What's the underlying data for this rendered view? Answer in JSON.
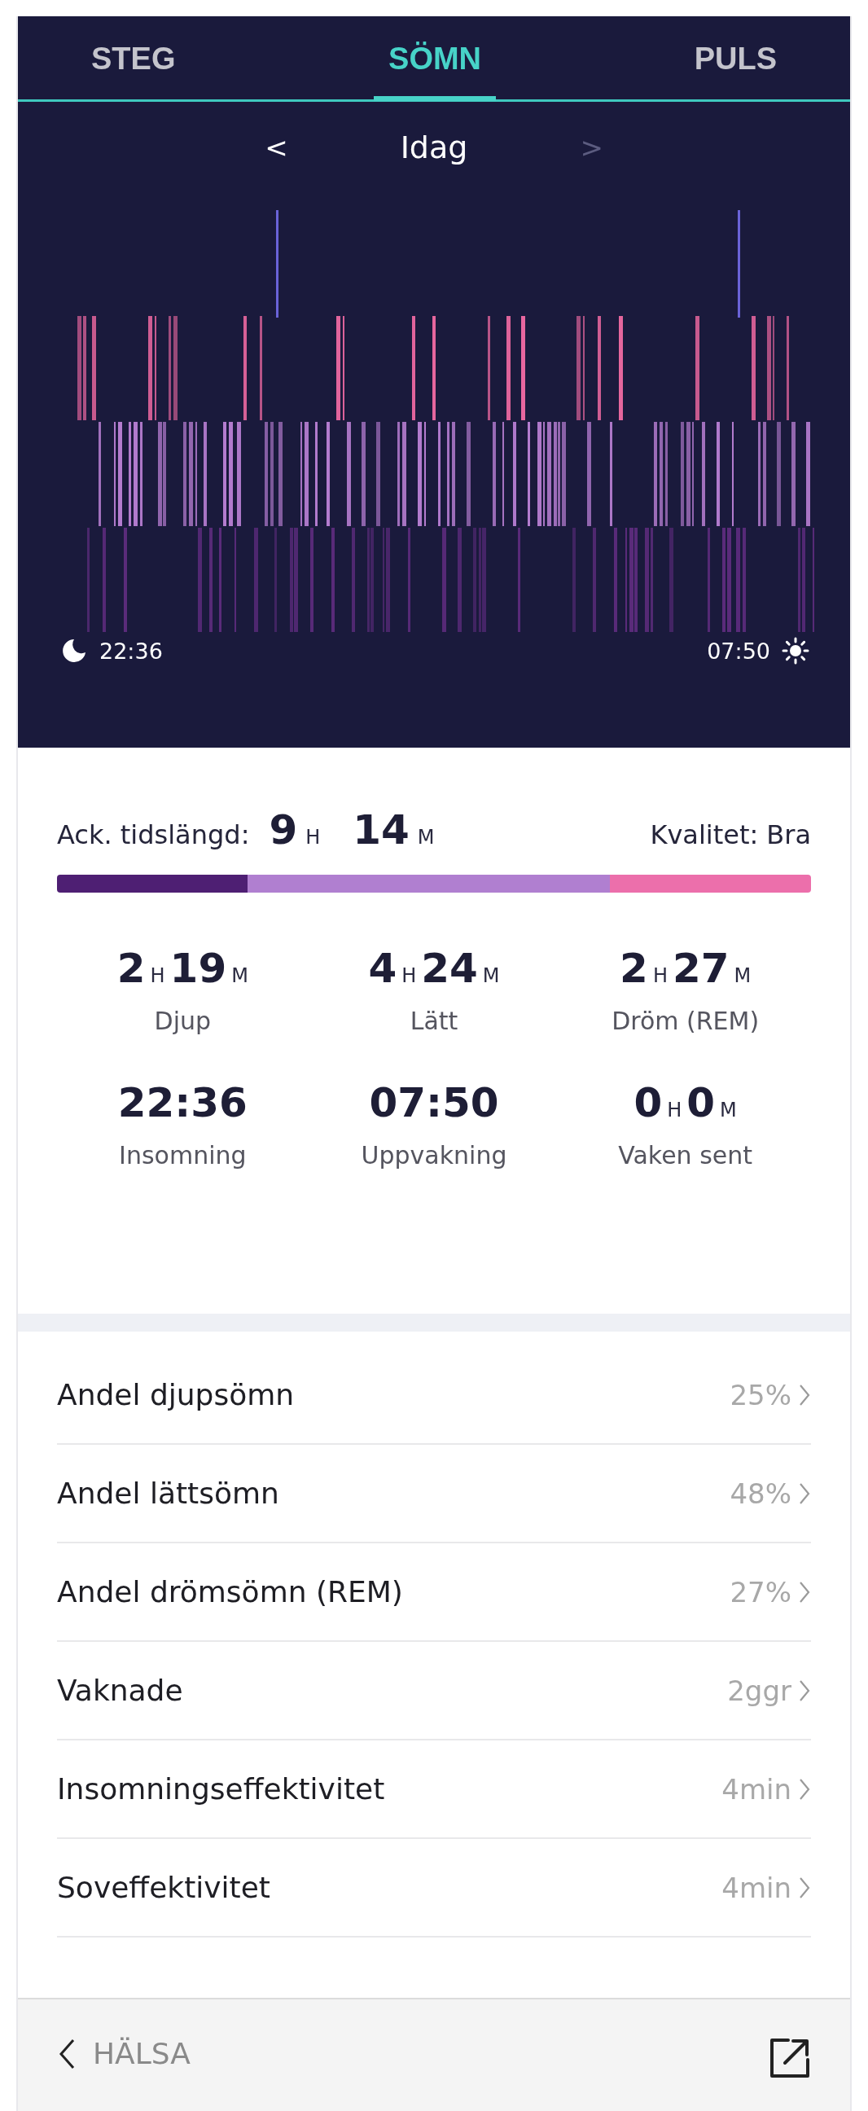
{
  "tabs": [
    {
      "label": "STEG",
      "selected": false
    },
    {
      "label": "SÖMN",
      "selected": true
    },
    {
      "label": "PULS",
      "selected": false
    }
  ],
  "date_nav": {
    "prev": "<",
    "label": "Idag",
    "next": ">",
    "next_disabled": true
  },
  "hypnogram": {
    "start_time": "22:36",
    "end_time": "07:50"
  },
  "summary": {
    "label": "Ack. tidslängd:",
    "hours": "9",
    "hours_unit": "H",
    "minutes": "14",
    "minutes_unit": "M",
    "quality_label": "Kvalitet:",
    "quality": "Bra"
  },
  "stage_bar": [
    {
      "color": "#4e1f73"
    },
    {
      "color": "#b07fd0"
    },
    {
      "color": "#ec6fab"
    }
  ],
  "stats": [
    {
      "kind": "duration",
      "hours": "2",
      "hours_unit": "H",
      "minutes": "19",
      "minutes_unit": "M",
      "label": "Djup"
    },
    {
      "kind": "duration",
      "hours": "4",
      "hours_unit": "H",
      "minutes": "24",
      "minutes_unit": "M",
      "label": "Lätt"
    },
    {
      "kind": "duration",
      "hours": "2",
      "hours_unit": "H",
      "minutes": "27",
      "minutes_unit": "M",
      "label": "Dröm (REM)"
    },
    {
      "kind": "time",
      "value": "22:36",
      "label": "Insomning"
    },
    {
      "kind": "time",
      "value": "07:50",
      "label": "Uppvakning"
    },
    {
      "kind": "duration",
      "hours": "0",
      "hours_unit": "H",
      "minutes": "0",
      "minutes_unit": "M",
      "label": "Vaken sent"
    }
  ],
  "details": [
    {
      "label": "Andel djupsömn",
      "value": "25%"
    },
    {
      "label": "Andel lättsömn",
      "value": "48%"
    },
    {
      "label": "Andel drömsömn (REM)",
      "value": "27%"
    },
    {
      "label": "Vaknade",
      "value": "2ggr"
    },
    {
      "label": "Insomningseffektivitet",
      "value": "4min"
    },
    {
      "label": "Soveffektivitet",
      "value": "4min"
    }
  ],
  "footer": {
    "back_label": "HÄLSA"
  }
}
